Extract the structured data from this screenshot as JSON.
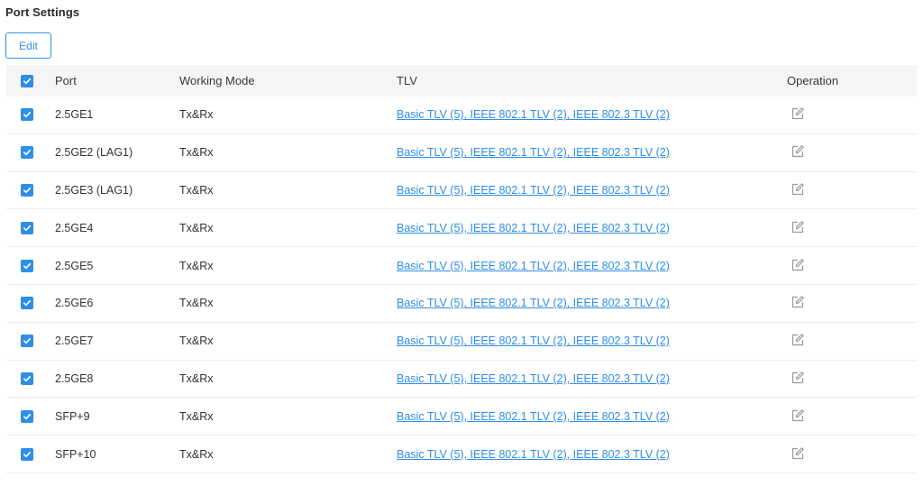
{
  "section": {
    "title": "Port Settings"
  },
  "toolbar": {
    "edit_label": "Edit"
  },
  "table": {
    "columns": {
      "port": "Port",
      "working_mode": "Working Mode",
      "tlv": "TLV",
      "operation": "Operation"
    },
    "header_checked": true,
    "rows": [
      {
        "port": "2.5GE1",
        "working_mode": "Tx&Rx",
        "tlv": "Basic TLV (5), IEEE 802.1 TLV (2), IEEE 802.3 TLV (2)",
        "checked": true
      },
      {
        "port": "2.5GE2 (LAG1)",
        "working_mode": "Tx&Rx",
        "tlv": "Basic TLV (5), IEEE 802.1 TLV (2), IEEE 802.3 TLV (2)",
        "checked": true
      },
      {
        "port": "2.5GE3 (LAG1)",
        "working_mode": "Tx&Rx",
        "tlv": "Basic TLV (5), IEEE 802.1 TLV (2), IEEE 802.3 TLV (2)",
        "checked": true
      },
      {
        "port": "2.5GE4",
        "working_mode": "Tx&Rx",
        "tlv": "Basic TLV (5), IEEE 802.1 TLV (2), IEEE 802.3 TLV (2)",
        "checked": true
      },
      {
        "port": "2.5GE5",
        "working_mode": "Tx&Rx",
        "tlv": "Basic TLV (5), IEEE 802.1 TLV (2), IEEE 802.3 TLV (2)",
        "checked": true
      },
      {
        "port": "2.5GE6",
        "working_mode": "Tx&Rx",
        "tlv": "Basic TLV (5), IEEE 802.1 TLV (2), IEEE 802.3 TLV (2)",
        "checked": true
      },
      {
        "port": "2.5GE7",
        "working_mode": "Tx&Rx",
        "tlv": "Basic TLV (5), IEEE 802.1 TLV (2), IEEE 802.3 TLV (2)",
        "checked": true
      },
      {
        "port": "2.5GE8",
        "working_mode": "Tx&Rx",
        "tlv": "Basic TLV (5), IEEE 802.1 TLV (2), IEEE 802.3 TLV (2)",
        "checked": true
      },
      {
        "port": "SFP+9",
        "working_mode": "Tx&Rx",
        "tlv": "Basic TLV (5), IEEE 802.1 TLV (2), IEEE 802.3 TLV (2)",
        "checked": true
      },
      {
        "port": "SFP+10",
        "working_mode": "Tx&Rx",
        "tlv": "Basic TLV (5), IEEE 802.1 TLV (2), IEEE 802.3 TLV (2)",
        "checked": true
      }
    ]
  },
  "icons": {
    "checkbox": "checkmark-icon",
    "operation": "edit-icon"
  },
  "colors": {
    "accent": "#2f8ee5",
    "header_bg": "#f4f5f7",
    "icon_gray": "#9a9a9a"
  }
}
